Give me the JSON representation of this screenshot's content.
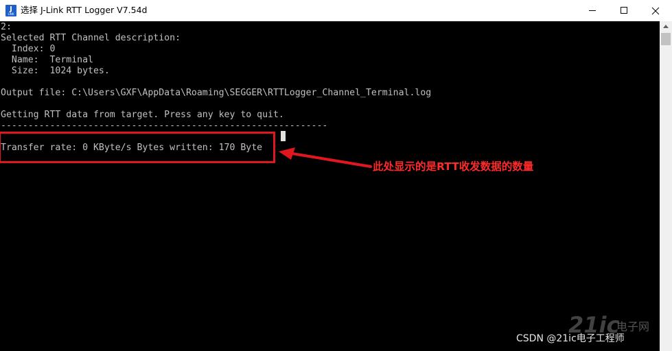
{
  "window": {
    "title": "选择 J-Link RTT Logger V7.54d",
    "icon": {
      "name": "jlink-app-icon",
      "big_text": "J",
      "small_text": "LINK",
      "color": "#1f5fc8"
    },
    "controls": {
      "minimize_icon": "minimize-icon",
      "maximize_icon": "maximize-icon",
      "close_icon": "close-icon"
    }
  },
  "console": {
    "background": "#000000",
    "text_color": "#c0c0c0",
    "lines": [
      "2:",
      "Selected RTT Channel description:",
      "  Index: 0",
      "  Name:  Terminal",
      "  Size:  1024 bytes.",
      "",
      "Output file: C:\\Users\\GXF\\AppData\\Roaming\\SEGGER\\RTTLogger_Channel_Terminal.log",
      "",
      "Getting RTT data from target. Press any key to quit.",
      "------------------------------------------------------------",
      "",
      "Transfer rate: 0 KByte/s Bytes written: 170 Byte"
    ]
  },
  "annotation": {
    "text": "此处显示的是RTT收发数据的数量",
    "color": "#ff2a2a",
    "box_color": "#e0171e"
  },
  "watermarks": {
    "logo": "21ic",
    "brand": "电子网",
    "csdn": "CSDN @21ic电子工程师"
  }
}
